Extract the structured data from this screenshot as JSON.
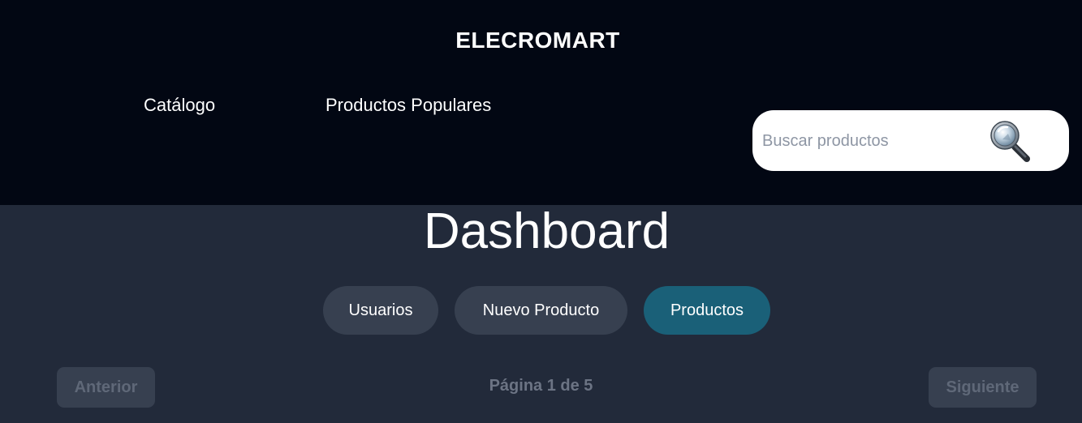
{
  "header": {
    "brand": "ELECROMART",
    "nav": [
      {
        "label": "Catálogo"
      },
      {
        "label": "Productos Populares"
      }
    ],
    "search": {
      "placeholder": "Buscar productos",
      "value": "",
      "icon": "magnifier-icon"
    }
  },
  "main": {
    "title": "Dashboard",
    "tabs": [
      {
        "label": "Usuarios",
        "active": false
      },
      {
        "label": "Nuevo Producto",
        "active": false
      },
      {
        "label": "Productos",
        "active": true
      }
    ],
    "pagination": {
      "prev_label": "Anterior",
      "next_label": "Siguiente",
      "page_info": "Página 1 de 5"
    }
  },
  "colors": {
    "header_bg": "#020713",
    "page_bg": "#222a3a",
    "tab_bg": "#374050",
    "tab_active_bg": "#1a6078",
    "muted_text": "#6c7484"
  }
}
